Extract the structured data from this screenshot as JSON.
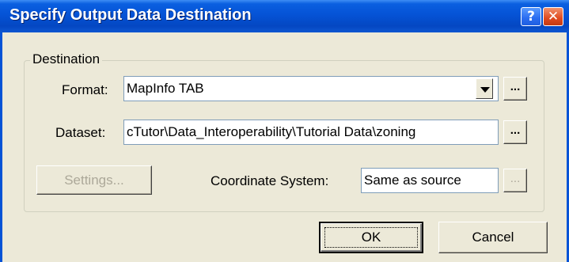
{
  "dialog": {
    "title": "Specify Output Data Destination",
    "help_glyph": "?",
    "close_glyph": "✕"
  },
  "destination": {
    "group_label": "Destination",
    "format_label": "Format:",
    "format_value": "MapInfo TAB",
    "dataset_label": "Dataset:",
    "dataset_value": "cTutor\\Data_Interoperability\\Tutorial Data\\zoning",
    "browse_label": "...",
    "settings_label": "Settings...",
    "coord_label": "Coordinate System:",
    "coord_value": "Same as source"
  },
  "buttons": {
    "ok_label": "OK",
    "cancel_label": "Cancel"
  },
  "colors": {
    "titlebar": "#0553d6",
    "dialog_bg": "#ece9d8",
    "disabled_text": "#aca899"
  },
  "icons": {
    "help": "help-icon",
    "close": "close-icon",
    "dropdown": "chevron-down-icon"
  }
}
